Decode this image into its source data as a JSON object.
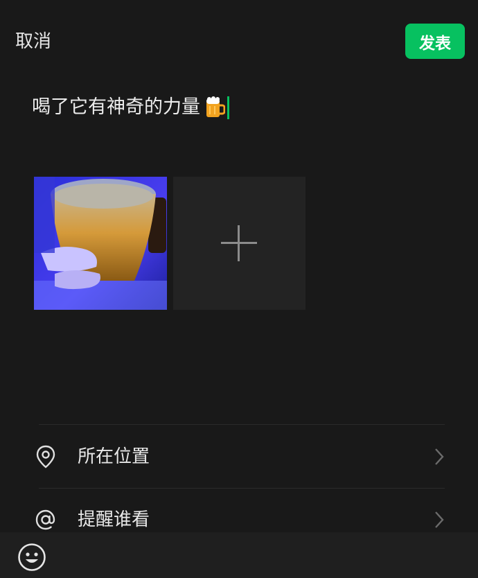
{
  "header": {
    "cancel_label": "取消",
    "publish_label": "发表",
    "publish_color": "#07c160"
  },
  "post": {
    "text": "喝了它有神奇的力量",
    "emoji": "beer-mug-icon"
  },
  "media": {
    "photos": [
      {
        "subject": "photo-beer-glass"
      }
    ],
    "add_icon": "plus-icon"
  },
  "options": [
    {
      "label": "所在位置",
      "icon": "location-pin-icon"
    },
    {
      "label": "提醒谁看",
      "icon": "at-mention-icon"
    }
  ],
  "toolbar": {
    "emoji_icon": "smiley-face-icon"
  }
}
